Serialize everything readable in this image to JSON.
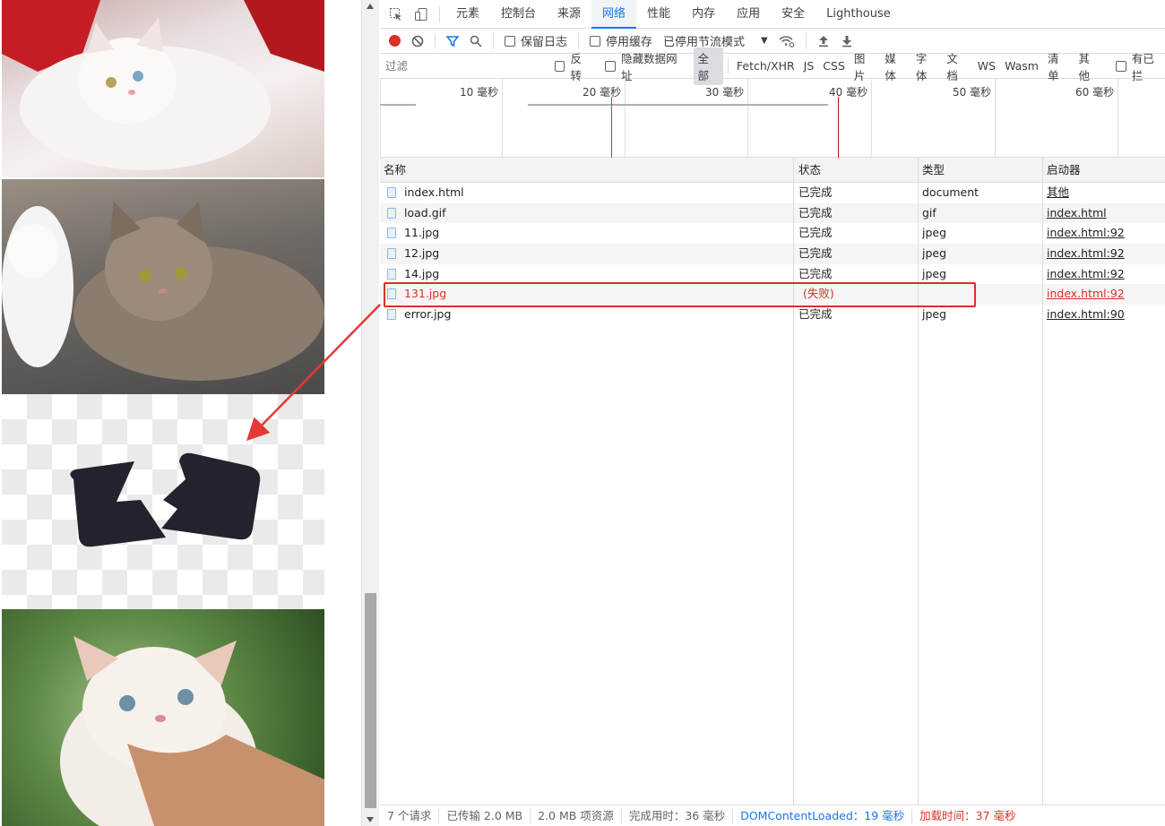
{
  "devtools": {
    "tabs": [
      "元素",
      "控制台",
      "来源",
      "网络",
      "性能",
      "内存",
      "应用",
      "安全",
      "Lighthouse"
    ],
    "active_tab": "网络",
    "toolbar": {
      "preserve_log": "保留日志",
      "disable_cache": "停用缓存",
      "throttling": "已停用节流模式"
    },
    "filter": {
      "placeholder": "过滤",
      "invert": "反转",
      "hide_data_urls": "隐藏数据网址",
      "types": [
        "全部",
        "Fetch/XHR",
        "JS",
        "CSS",
        "图片",
        "媒体",
        "字体",
        "文档",
        "WS",
        "Wasm",
        "清单",
        "其他"
      ],
      "active_type": "全部",
      "blocked": "有已拦"
    },
    "overview_ticks": [
      "10 毫秒",
      "20 毫秒",
      "30 毫秒",
      "40 毫秒",
      "50 毫秒",
      "60 毫秒"
    ],
    "columns": {
      "name": "名称",
      "status": "状态",
      "type": "类型",
      "initiator": "启动器"
    },
    "requests": [
      {
        "name": "index.html",
        "status": "已完成",
        "type": "document",
        "initiator": "其他",
        "failed": false
      },
      {
        "name": "load.gif",
        "status": "已完成",
        "type": "gif",
        "initiator": "index.html",
        "failed": false
      },
      {
        "name": "11.jpg",
        "status": "已完成",
        "type": "jpeg",
        "initiator": "index.html:92",
        "failed": false
      },
      {
        "name": "12.jpg",
        "status": "已完成",
        "type": "jpeg",
        "initiator": "index.html:92",
        "failed": false
      },
      {
        "name": "14.jpg",
        "status": "已完成",
        "type": "jpeg",
        "initiator": "index.html:92",
        "failed": false
      },
      {
        "name": "131.jpg",
        "status": "(失败)",
        "type": "",
        "initiator": "index.html:92",
        "failed": true
      },
      {
        "name": "error.jpg",
        "status": "已完成",
        "type": "jpeg",
        "initiator": "index.html:90",
        "failed": false
      }
    ],
    "status_bar": {
      "requests": "7 个请求",
      "transferred": "已传输 2.0 MB",
      "resources": "2.0 MB 项资源",
      "finish": "完成用时：36 毫秒",
      "dom_content_loaded": "DOMContentLoaded：19 毫秒",
      "load": "加载时间：37 毫秒"
    },
    "colors": {
      "accent": "#1a73e8",
      "error": "#d93025"
    }
  }
}
